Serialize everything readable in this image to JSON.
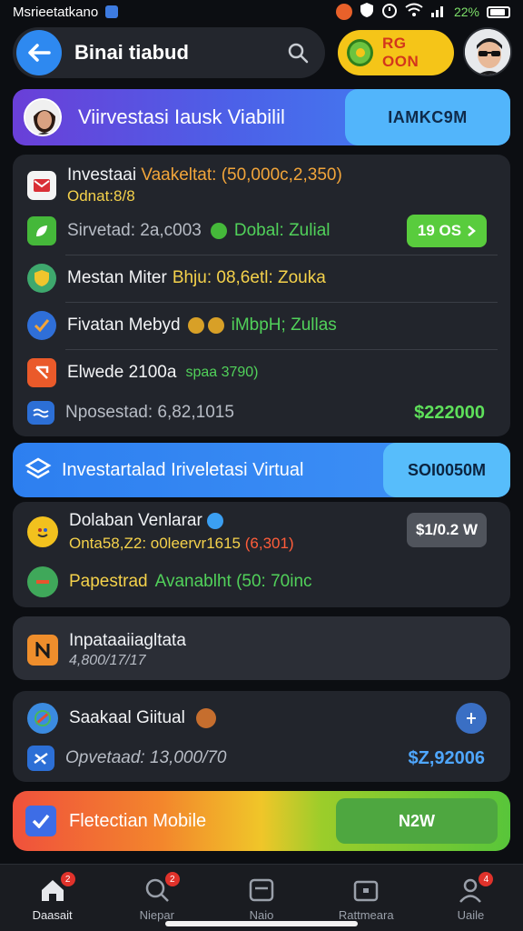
{
  "status_bar": {
    "carrier": "Msrieetatkano",
    "battery": "22%"
  },
  "header": {
    "title": "Binai tiabud",
    "coin_label": "RG OON"
  },
  "banner": {
    "title": "Viirvestasi Iausk Viabilil",
    "right_label": "IAMKC9M"
  },
  "card1": {
    "row1": {
      "title": "Investaai",
      "title_extra": "Vaakeltat: (50,000c,2,350)",
      "sub": "Odnat:8/8"
    },
    "row2": {
      "label": "Sirvetad: 2a,c003",
      "extra": "Dobal: Zulial",
      "button": "19 OS"
    },
    "row3": {
      "label": "Mestan Miter",
      "extra": "Bhju: 08,6etl: Zouka"
    },
    "row4": {
      "label": "Fivatan Mebyd",
      "extra": "iMbpH; Zullas"
    },
    "row5": {
      "label": "Elwede 2100a",
      "extra": "spaa 3790)"
    },
    "row6": {
      "label": "Nposestad: 6,82,1015",
      "amount": "$222000"
    }
  },
  "banner2": {
    "title": "Investartalad Iriveletasi Virtual",
    "right_label": "SOI0050M"
  },
  "card2": {
    "row1": {
      "title": "Dolaban Venlarar",
      "sub": "Onta58,Z2: o0leervr1615",
      "sub_extra": "(6,301)",
      "button": "$1/0.2 W"
    },
    "row2": {
      "label": "Papestrad",
      "extra": "Avanablht (50: 70inc"
    }
  },
  "card3": {
    "title": "Inpataaiiagltata",
    "sub": "4,800/17/17"
  },
  "card4": {
    "title": "Saakaal Giitual",
    "sub": "Opvetaad: 13,000/70",
    "amount": "$Z,92006"
  },
  "cta": {
    "label": "Fletectian Mobile",
    "button": "N2W"
  },
  "bottom_nav": {
    "items": [
      {
        "label": "Daasait",
        "badge": "2"
      },
      {
        "label": "Niepar",
        "badge": "2"
      },
      {
        "label": "Naio",
        "badge": ""
      },
      {
        "label": "Rattmeara",
        "badge": ""
      },
      {
        "label": "Uaile",
        "badge": "4"
      }
    ]
  },
  "colors": {
    "accent": "#2e89f0",
    "coin": "#f5c518",
    "go_green": "#59cc3d"
  }
}
